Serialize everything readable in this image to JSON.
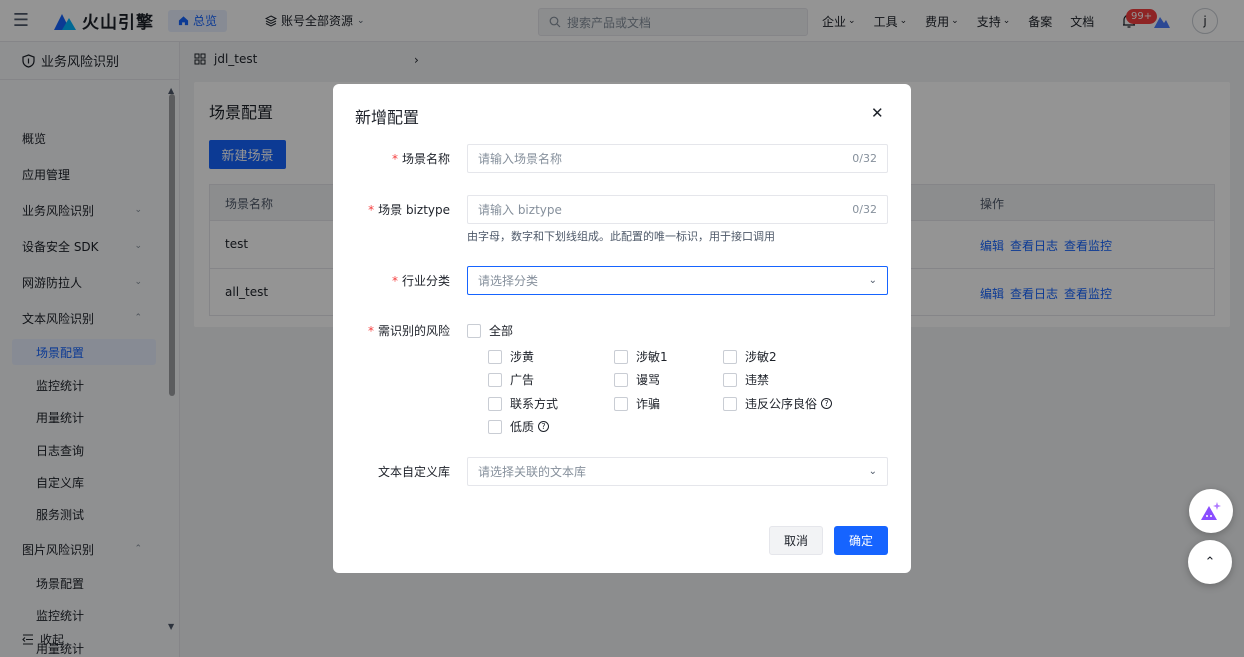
{
  "topbar": {
    "brand": "火山引擎",
    "home": "总览",
    "account": "账号全部资源",
    "search_placeholder": "搜索产品或文档",
    "nav": [
      "企业",
      "工具",
      "费用",
      "支持"
    ],
    "links": [
      "备案",
      "文档"
    ],
    "badge": "99+",
    "avatar": "j"
  },
  "sidebar": {
    "title": "业务风险识别",
    "items": [
      {
        "label": "概览"
      },
      {
        "label": "应用管理"
      },
      {
        "label": "业务风险识别"
      },
      {
        "label": "设备安全 SDK"
      },
      {
        "label": "网游防拉人"
      },
      {
        "label": "文本风险识别"
      },
      {
        "label": "场景配置"
      },
      {
        "label": "监控统计"
      },
      {
        "label": "用量统计"
      },
      {
        "label": "日志查询"
      },
      {
        "label": "自定义库"
      },
      {
        "label": "服务测试"
      },
      {
        "label": "图片风险识别"
      },
      {
        "label": "场景配置"
      },
      {
        "label": "监控统计"
      },
      {
        "label": "用量统计"
      }
    ],
    "collapse": "收起"
  },
  "breadcrumb": {
    "app": "jdl_test"
  },
  "page": {
    "title": "场景配置",
    "new_button": "新建场景",
    "columns": {
      "name": "场景名称",
      "ops": "操作"
    },
    "rows": [
      {
        "name": "test",
        "ops": [
          "编辑",
          "查看日志",
          "查看监控"
        ]
      },
      {
        "name": "all_test",
        "ops": [
          "编辑",
          "查看日志",
          "查看监控"
        ]
      }
    ]
  },
  "dialog": {
    "title": "新增配置",
    "fields": {
      "scene_name": {
        "label": "场景名称",
        "placeholder": "请输入场景名称",
        "count": "0/32"
      },
      "biztype": {
        "label": "场景 biztype",
        "placeholder": "请输入 biztype",
        "count": "0/32",
        "hint": "由字母，数字和下划线组成。此配置的唯一标识，用于接口调用"
      },
      "industry": {
        "label": "行业分类",
        "placeholder": "请选择分类"
      },
      "risks": {
        "label": "需识别的风险",
        "all": "全部",
        "options": [
          "涉黄",
          "涉敏1",
          "涉敏2",
          "广告",
          "谩骂",
          "违禁",
          "联系方式",
          "诈骗",
          "违反公序良俗",
          "低质"
        ]
      },
      "library": {
        "label": "文本自定义库",
        "placeholder": "请选择关联的文本库"
      }
    },
    "cancel": "取消",
    "confirm": "确定"
  }
}
